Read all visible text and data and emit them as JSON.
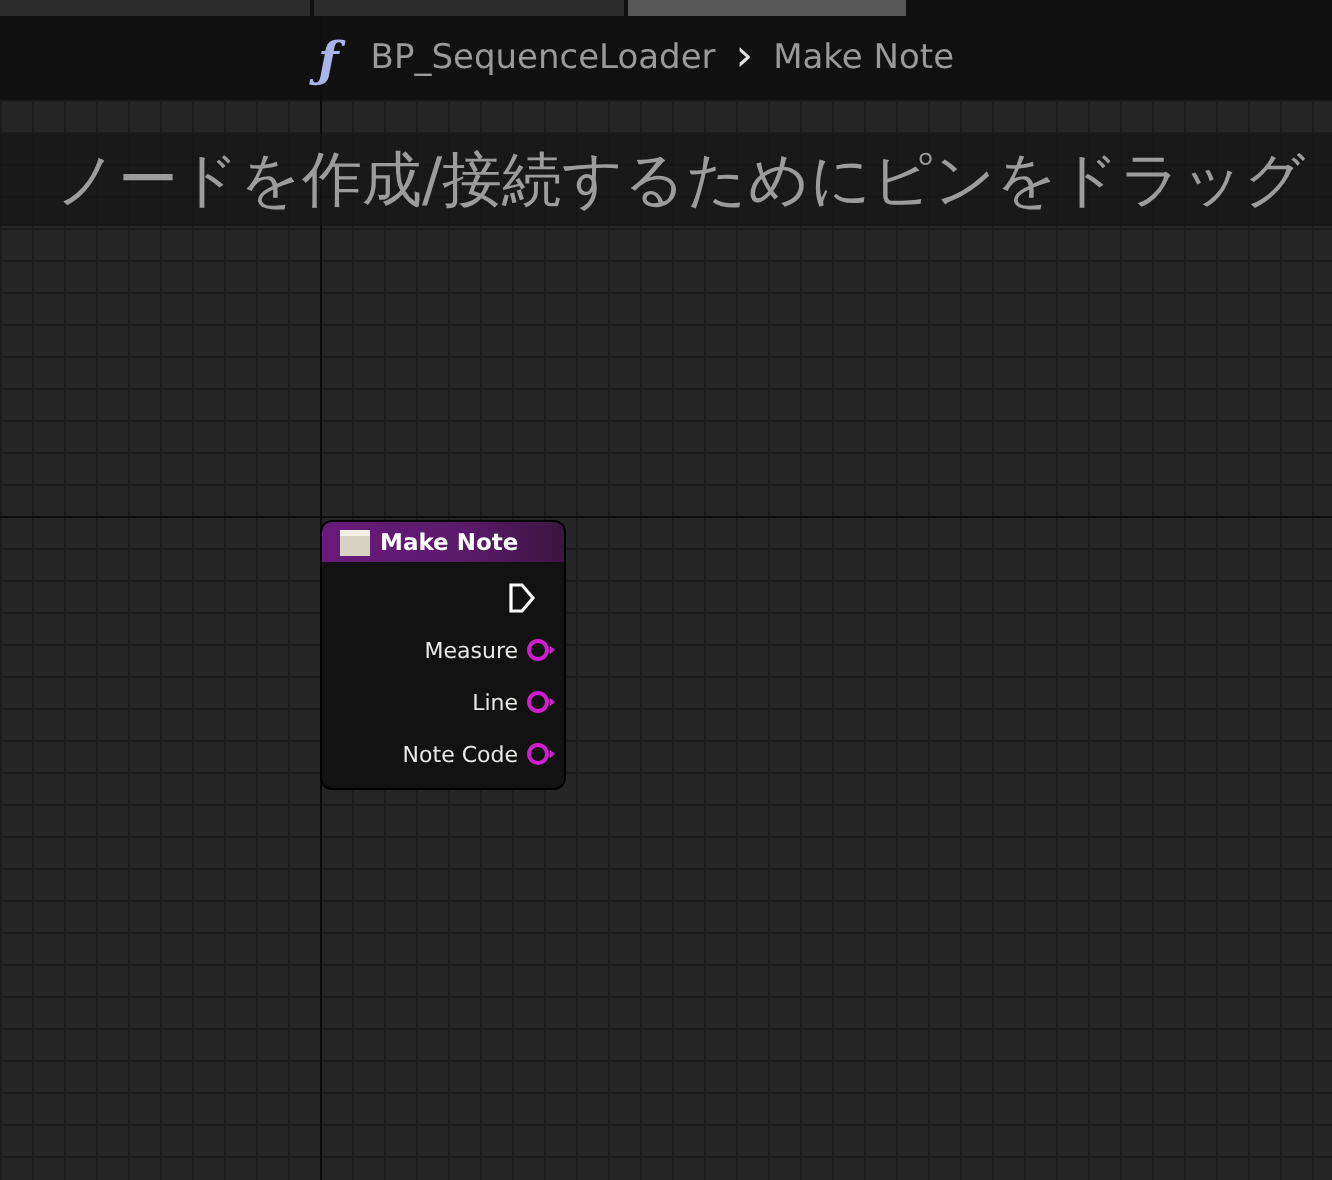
{
  "tabs": [
    {
      "selected": false
    },
    {
      "selected": false
    },
    {
      "selected": true
    }
  ],
  "breadcrumb": {
    "icon": "ƒ",
    "graph": "BP_SequenceLoader",
    "separator": "›",
    "function": "Make Note"
  },
  "hint": "ノードを作成/接続するためにピンをドラッグ",
  "node": {
    "title": "Make Note",
    "pins": [
      {
        "kind": "exec"
      },
      {
        "kind": "data",
        "label": "Measure"
      },
      {
        "kind": "data",
        "label": "Line"
      },
      {
        "kind": "data",
        "label": "Note Code"
      }
    ]
  }
}
